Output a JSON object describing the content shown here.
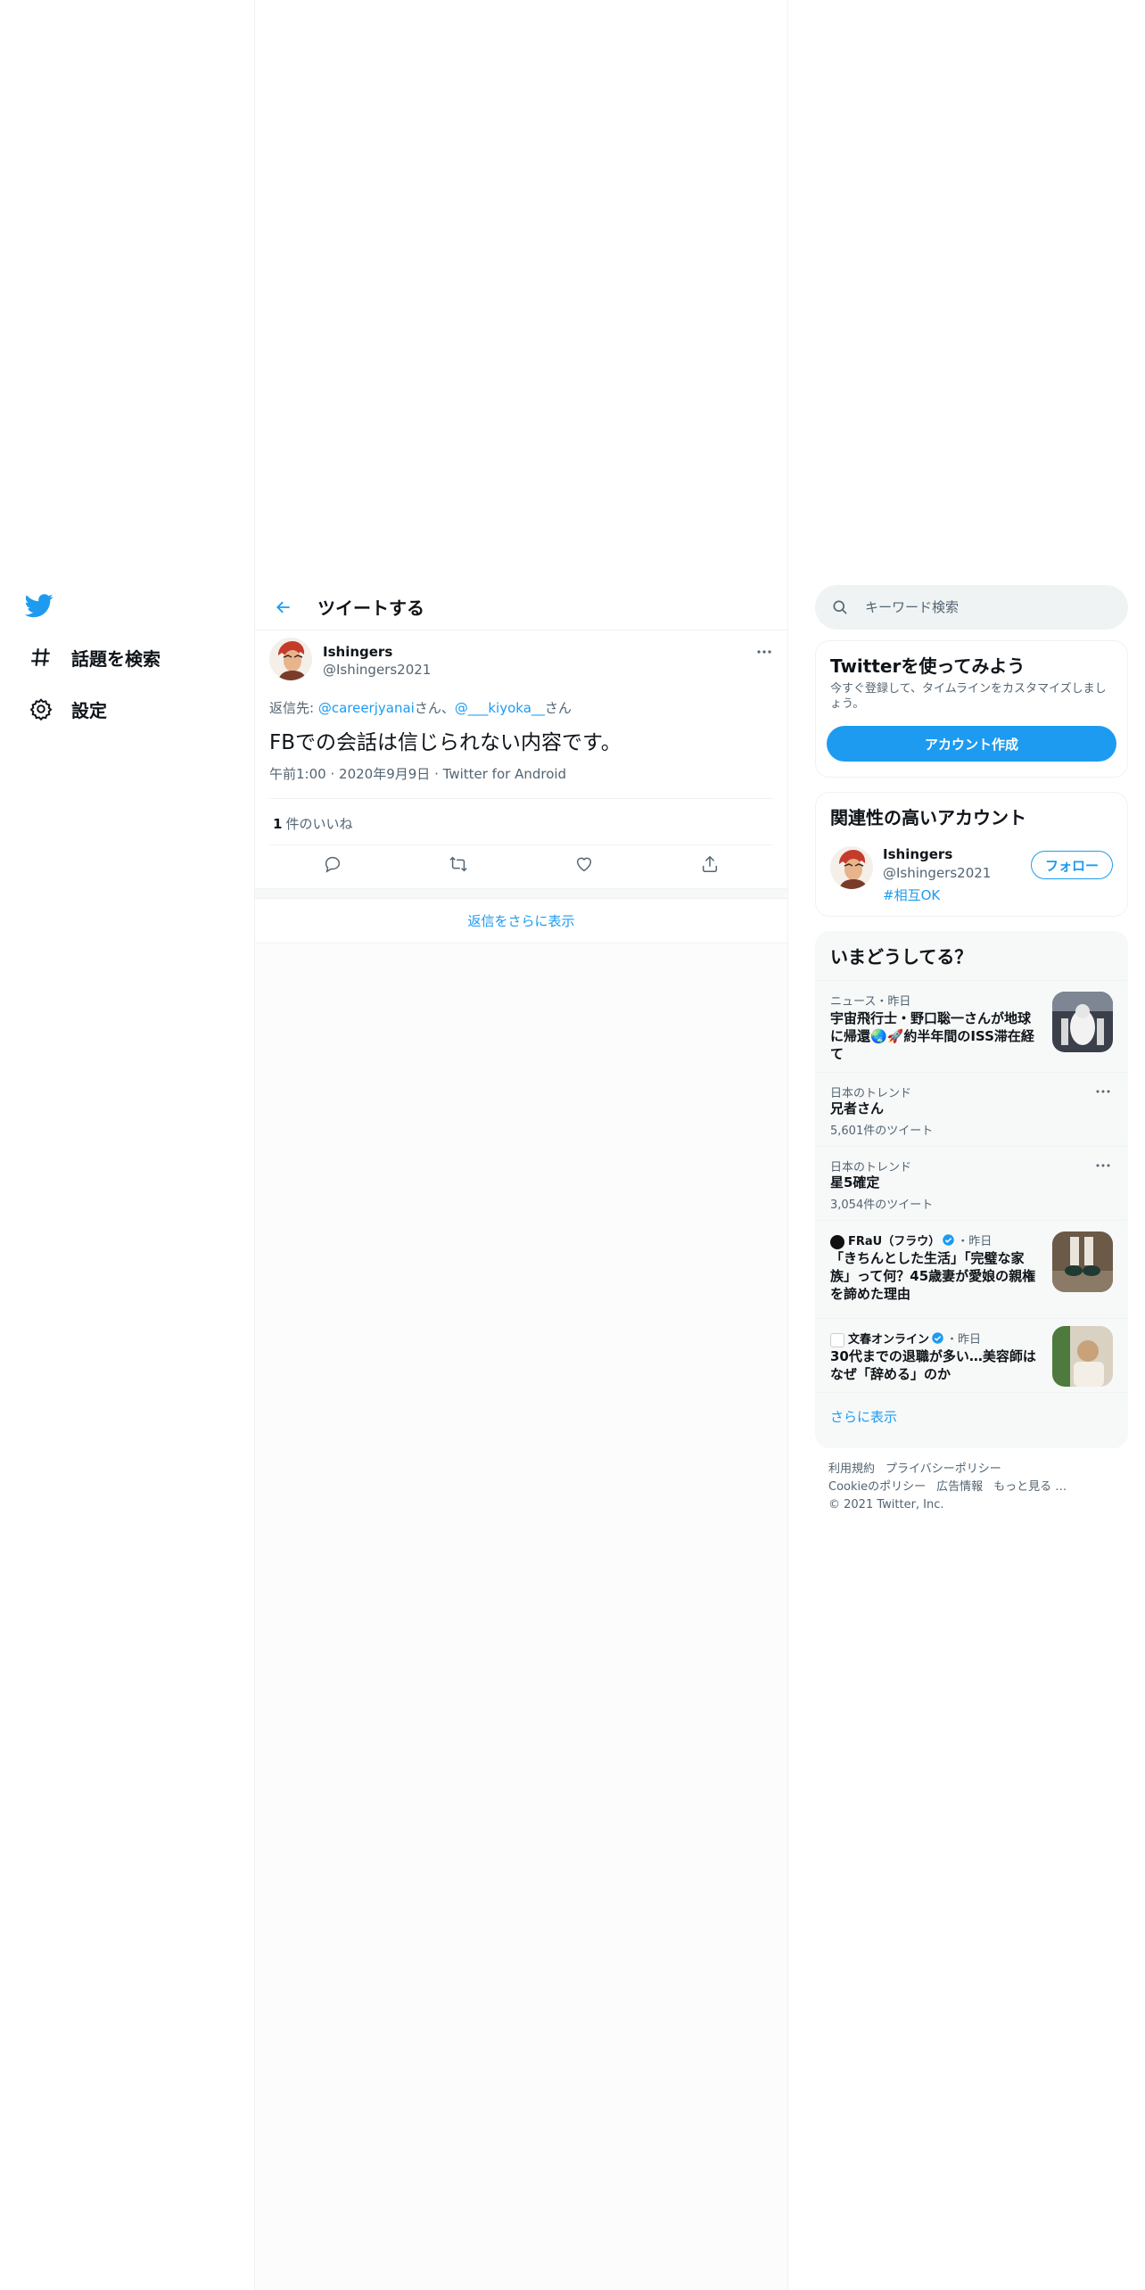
{
  "nav": {
    "items": [
      {
        "label": "話題を検索",
        "icon": "hashtag-icon"
      },
      {
        "label": "設定",
        "icon": "gear-icon"
      }
    ]
  },
  "header": {
    "title": "ツイートする"
  },
  "tweet": {
    "author_name": "Ishingers",
    "author_handle": "@Ishingers2021",
    "reply_prefix": "返信先: ",
    "reply_user1": "@careerjyanai",
    "reply_suffix1": "さん、",
    "reply_user2": "@___kiyoka__",
    "reply_suffix2": "さん",
    "text": "FBでの会話は信じられない内容です。",
    "time": "午前1:00",
    "date": "2020年9月9日",
    "client": "Twitter for Android",
    "separator": "·",
    "like_count": "1",
    "like_label": "件のいいね"
  },
  "show_more_replies": "返信をさらに表示",
  "search": {
    "placeholder": "キーワード検索"
  },
  "signup": {
    "title": "Twitterを使ってみよう",
    "description": "今すぐ登録して、タイムラインをカスタマイズしましょう。",
    "button": "アカウント作成"
  },
  "relevant": {
    "title": "関連性の高いアカウント",
    "name": "Ishingers",
    "handle": "@Ishingers2021",
    "tag": "#相互OK",
    "follow": "フォロー"
  },
  "trends": {
    "title": "いまどうしてる？",
    "items": [
      {
        "sub": "ニュース・昨日",
        "title_line1": "宇宙飛行士・野口聡一さんが地球",
        "title_line2": "に帰還🌏🚀約半年間のISS滞在経",
        "title_line3": "て"
      },
      {
        "sub": "日本のトレンド",
        "title": "兄者さん",
        "count": "5,601件のツイート"
      },
      {
        "sub": "日本のトレンド",
        "title": "星5確定",
        "count": "3,054件のツイート"
      },
      {
        "source": "FRaU（フラウ）",
        "time": "・昨日",
        "title_line1": "「きちんとした生活」「完璧な家",
        "title_line2": "族」って何？45歳妻が愛娘の親権",
        "title_line3": "を諦めた理由"
      },
      {
        "source": "文春オンライン",
        "time": "・昨日",
        "title_line1": "30代までの退職が多い…美容師は",
        "title_line2": "なぜ「辞める」のか"
      }
    ],
    "show_more": "さらに表示"
  },
  "footer": {
    "terms": "利用規約",
    "privacy": "プライバシーポリシー",
    "cookie": "Cookieのポリシー",
    "ads": "広告情報",
    "more": "もっと見る …",
    "copyright": "© 2021 Twitter, Inc."
  },
  "colors": {
    "accent": "#1d9bf0",
    "text": "#0f1419",
    "muted": "#536471"
  }
}
